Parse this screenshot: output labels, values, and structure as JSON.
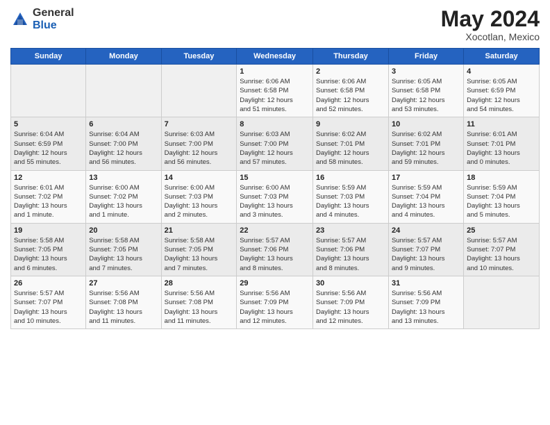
{
  "header": {
    "logo_general": "General",
    "logo_blue": "Blue",
    "title": "May 2024",
    "location": "Xocotlan, Mexico"
  },
  "weekdays": [
    "Sunday",
    "Monday",
    "Tuesday",
    "Wednesday",
    "Thursday",
    "Friday",
    "Saturday"
  ],
  "weeks": [
    [
      {
        "num": "",
        "info": ""
      },
      {
        "num": "",
        "info": ""
      },
      {
        "num": "",
        "info": ""
      },
      {
        "num": "1",
        "info": "Sunrise: 6:06 AM\nSunset: 6:58 PM\nDaylight: 12 hours\nand 51 minutes."
      },
      {
        "num": "2",
        "info": "Sunrise: 6:06 AM\nSunset: 6:58 PM\nDaylight: 12 hours\nand 52 minutes."
      },
      {
        "num": "3",
        "info": "Sunrise: 6:05 AM\nSunset: 6:58 PM\nDaylight: 12 hours\nand 53 minutes."
      },
      {
        "num": "4",
        "info": "Sunrise: 6:05 AM\nSunset: 6:59 PM\nDaylight: 12 hours\nand 54 minutes."
      }
    ],
    [
      {
        "num": "5",
        "info": "Sunrise: 6:04 AM\nSunset: 6:59 PM\nDaylight: 12 hours\nand 55 minutes."
      },
      {
        "num": "6",
        "info": "Sunrise: 6:04 AM\nSunset: 7:00 PM\nDaylight: 12 hours\nand 56 minutes."
      },
      {
        "num": "7",
        "info": "Sunrise: 6:03 AM\nSunset: 7:00 PM\nDaylight: 12 hours\nand 56 minutes."
      },
      {
        "num": "8",
        "info": "Sunrise: 6:03 AM\nSunset: 7:00 PM\nDaylight: 12 hours\nand 57 minutes."
      },
      {
        "num": "9",
        "info": "Sunrise: 6:02 AM\nSunset: 7:01 PM\nDaylight: 12 hours\nand 58 minutes."
      },
      {
        "num": "10",
        "info": "Sunrise: 6:02 AM\nSunset: 7:01 PM\nDaylight: 12 hours\nand 59 minutes."
      },
      {
        "num": "11",
        "info": "Sunrise: 6:01 AM\nSunset: 7:01 PM\nDaylight: 13 hours\nand 0 minutes."
      }
    ],
    [
      {
        "num": "12",
        "info": "Sunrise: 6:01 AM\nSunset: 7:02 PM\nDaylight: 13 hours\nand 1 minute."
      },
      {
        "num": "13",
        "info": "Sunrise: 6:00 AM\nSunset: 7:02 PM\nDaylight: 13 hours\nand 1 minute."
      },
      {
        "num": "14",
        "info": "Sunrise: 6:00 AM\nSunset: 7:03 PM\nDaylight: 13 hours\nand 2 minutes."
      },
      {
        "num": "15",
        "info": "Sunrise: 6:00 AM\nSunset: 7:03 PM\nDaylight: 13 hours\nand 3 minutes."
      },
      {
        "num": "16",
        "info": "Sunrise: 5:59 AM\nSunset: 7:03 PM\nDaylight: 13 hours\nand 4 minutes."
      },
      {
        "num": "17",
        "info": "Sunrise: 5:59 AM\nSunset: 7:04 PM\nDaylight: 13 hours\nand 4 minutes."
      },
      {
        "num": "18",
        "info": "Sunrise: 5:59 AM\nSunset: 7:04 PM\nDaylight: 13 hours\nand 5 minutes."
      }
    ],
    [
      {
        "num": "19",
        "info": "Sunrise: 5:58 AM\nSunset: 7:05 PM\nDaylight: 13 hours\nand 6 minutes."
      },
      {
        "num": "20",
        "info": "Sunrise: 5:58 AM\nSunset: 7:05 PM\nDaylight: 13 hours\nand 7 minutes."
      },
      {
        "num": "21",
        "info": "Sunrise: 5:58 AM\nSunset: 7:05 PM\nDaylight: 13 hours\nand 7 minutes."
      },
      {
        "num": "22",
        "info": "Sunrise: 5:57 AM\nSunset: 7:06 PM\nDaylight: 13 hours\nand 8 minutes."
      },
      {
        "num": "23",
        "info": "Sunrise: 5:57 AM\nSunset: 7:06 PM\nDaylight: 13 hours\nand 8 minutes."
      },
      {
        "num": "24",
        "info": "Sunrise: 5:57 AM\nSunset: 7:07 PM\nDaylight: 13 hours\nand 9 minutes."
      },
      {
        "num": "25",
        "info": "Sunrise: 5:57 AM\nSunset: 7:07 PM\nDaylight: 13 hours\nand 10 minutes."
      }
    ],
    [
      {
        "num": "26",
        "info": "Sunrise: 5:57 AM\nSunset: 7:07 PM\nDaylight: 13 hours\nand 10 minutes."
      },
      {
        "num": "27",
        "info": "Sunrise: 5:56 AM\nSunset: 7:08 PM\nDaylight: 13 hours\nand 11 minutes."
      },
      {
        "num": "28",
        "info": "Sunrise: 5:56 AM\nSunset: 7:08 PM\nDaylight: 13 hours\nand 11 minutes."
      },
      {
        "num": "29",
        "info": "Sunrise: 5:56 AM\nSunset: 7:09 PM\nDaylight: 13 hours\nand 12 minutes."
      },
      {
        "num": "30",
        "info": "Sunrise: 5:56 AM\nSunset: 7:09 PM\nDaylight: 13 hours\nand 12 minutes."
      },
      {
        "num": "31",
        "info": "Sunrise: 5:56 AM\nSunset: 7:09 PM\nDaylight: 13 hours\nand 13 minutes."
      },
      {
        "num": "",
        "info": ""
      }
    ]
  ]
}
